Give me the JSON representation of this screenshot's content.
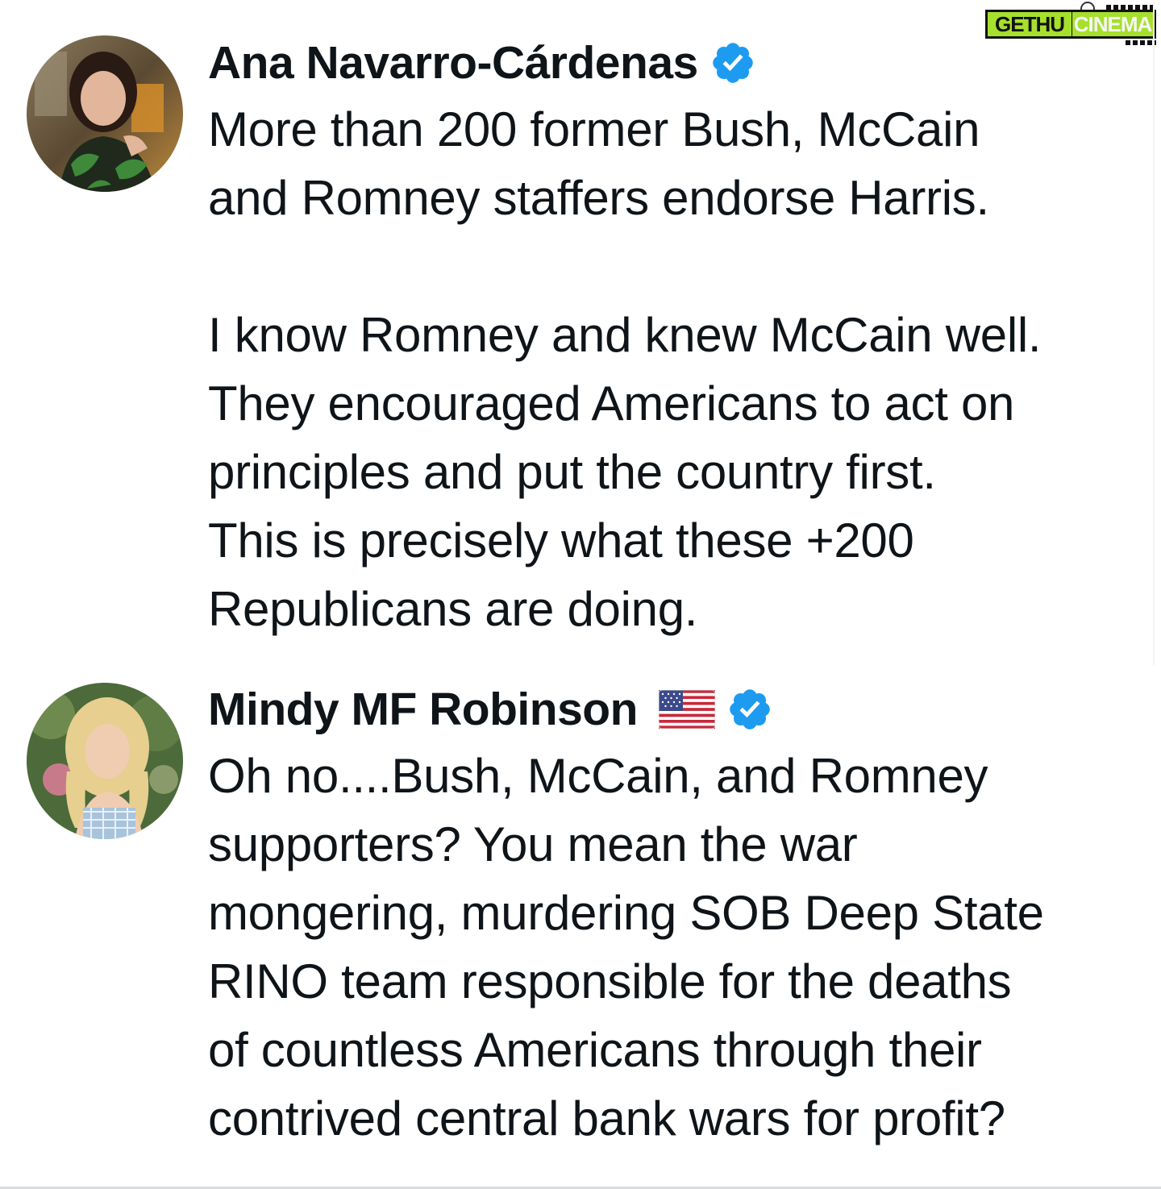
{
  "watermark": {
    "part1": "GETHU",
    "part2": "CINEMA"
  },
  "tweets": [
    {
      "display_name": "Ana Navarro-Cárdenas",
      "verified": true,
      "text": "More than 200 former Bush, McCain\nand Romney staffers endorse Harris.\n\nI know Romney and knew McCain well.\nThey encouraged Americans to act on\nprinciples and put the country first.\nThis is precisely what these +200\nRepublicans are doing."
    },
    {
      "display_name": "Mindy MF Robinson",
      "flag_icon": "us-flag-icon",
      "verified": true,
      "text": "Oh no....Bush, McCain, and Romney\nsupporters? You mean the war\nmongering, murdering SOB Deep State\nRINO team responsible for the deaths\nof countless Americans through their\ncontrived central bank wars for profit?"
    }
  ],
  "colors": {
    "text": "#0f1419",
    "verified_badge": "#1d9bf0",
    "logo_green": "#a6e02c"
  }
}
